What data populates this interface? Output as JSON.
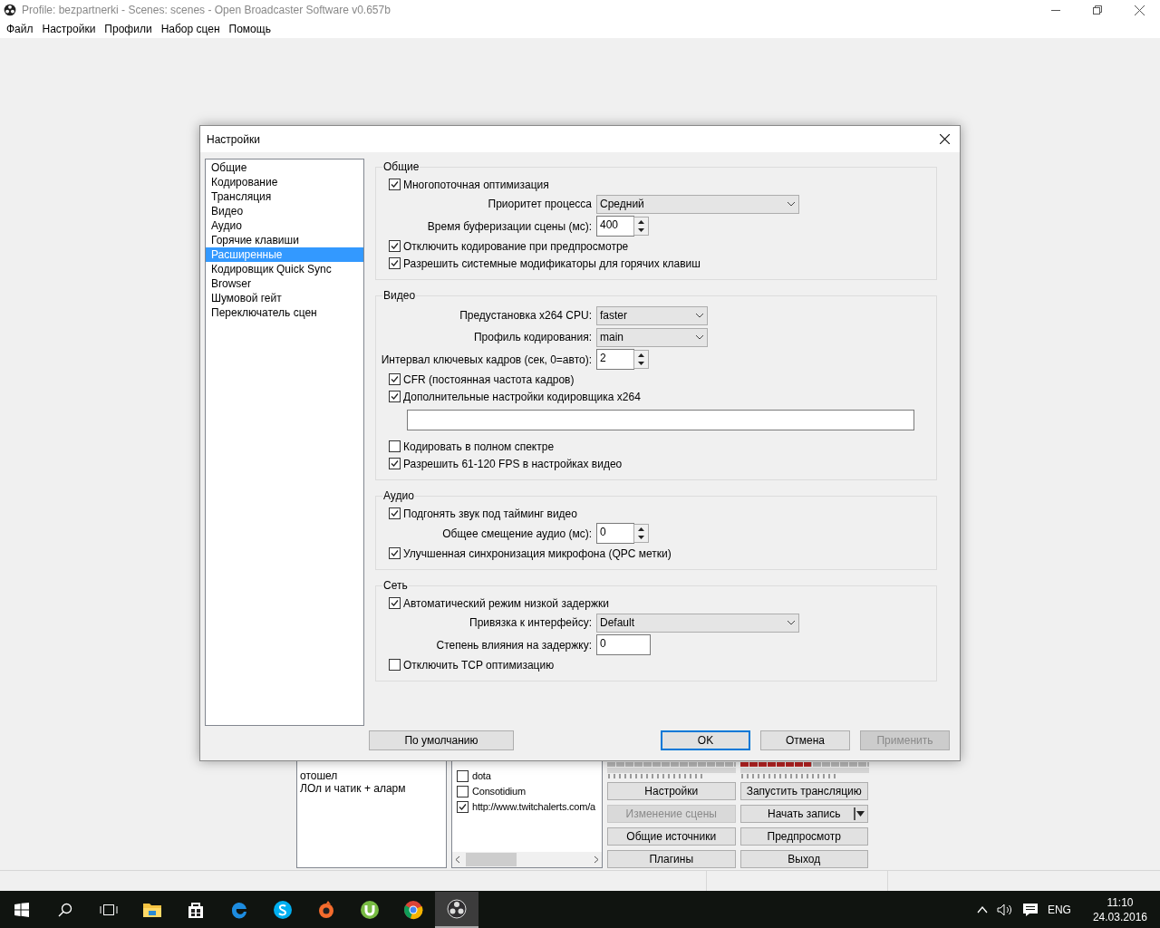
{
  "window": {
    "title": "Profile: bezpartnerki - Scenes: scenes - Open Broadcaster Software v0.657b"
  },
  "menu": [
    "Файл",
    "Настройки",
    "Профили",
    "Набор сцен",
    "Помощь"
  ],
  "main": {
    "scenes": [
      "отошел",
      "ЛОл и чатик + аларм"
    ],
    "sources": [
      {
        "label": "dota",
        "checked": false
      },
      {
        "label": "Consotidium",
        "checked": false
      },
      {
        "label": "http://www.twitchalerts.com/a",
        "checked": true
      }
    ],
    "meters": [
      {
        "level": 0
      },
      {
        "level": 0.55
      }
    ],
    "buttons": [
      {
        "label": "Настройки",
        "disabled": false,
        "kind": "plain"
      },
      {
        "label": "Запустить трансляцию",
        "disabled": false,
        "kind": "plain"
      },
      {
        "label": "Изменение сцены",
        "disabled": true,
        "kind": "plain"
      },
      {
        "label": "Начать запись",
        "disabled": false,
        "kind": "split"
      },
      {
        "label": "Общие источники",
        "disabled": false,
        "kind": "plain"
      },
      {
        "label": "Предпросмотр",
        "disabled": false,
        "kind": "plain"
      },
      {
        "label": "Плагины",
        "disabled": false,
        "kind": "plain"
      },
      {
        "label": "Выход",
        "disabled": false,
        "kind": "plain"
      }
    ]
  },
  "dialog": {
    "title": "Настройки",
    "nav": [
      {
        "label": "Общие",
        "selected": false
      },
      {
        "label": "Кодирование",
        "selected": false
      },
      {
        "label": "Трансляция",
        "selected": false
      },
      {
        "label": "Видео",
        "selected": false
      },
      {
        "label": "Аудио",
        "selected": false
      },
      {
        "label": "Горячие клавиши",
        "selected": false
      },
      {
        "label": "Расширенные",
        "selected": true
      },
      {
        "label": "Кодировщик Quick Sync",
        "selected": false
      },
      {
        "label": "Browser",
        "selected": false
      },
      {
        "label": "Шумовой гейт",
        "selected": false
      },
      {
        "label": "Переключатель сцен",
        "selected": false
      }
    ],
    "groups": [
      {
        "title": "Общие",
        "rows": [
          {
            "kind": "checkbox",
            "label": "Многопоточная оптимизация",
            "checked": true
          },
          {
            "kind": "dropdown",
            "label": "Приоритет процесса",
            "value": "Средний",
            "wide": true
          },
          {
            "kind": "spin",
            "label": "Время буферизации сцены (мс):",
            "value": "400"
          },
          {
            "kind": "checkbox",
            "label": "Отключить кодирование при предпросмотре",
            "checked": true
          },
          {
            "kind": "checkbox",
            "label": "Разрешить системные модификаторы для горячих клавиш",
            "checked": true
          }
        ]
      },
      {
        "title": "Видео",
        "rows": [
          {
            "kind": "dropdown",
            "label": "Предустановка x264 CPU:",
            "value": "faster",
            "wide": false
          },
          {
            "kind": "dropdown",
            "label": "Профиль кодирования:",
            "value": "main",
            "wide": false
          },
          {
            "kind": "spin",
            "label": "Интервал ключевых кадров (сек, 0=авто):",
            "value": "2"
          },
          {
            "kind": "checkbox",
            "label": "CFR (постоянная частота кадров)",
            "checked": true
          },
          {
            "kind": "checkbox",
            "label": "Дополнительные настройки кодировщика x264",
            "checked": true
          },
          {
            "kind": "field"
          },
          {
            "kind": "checkbox",
            "label": "Кодировать в полном спектре",
            "checked": false
          },
          {
            "kind": "checkbox",
            "label": "Разрешить 61-120 FPS в настройках видео",
            "checked": true
          }
        ]
      },
      {
        "title": "Аудио",
        "rows": [
          {
            "kind": "checkbox",
            "label": "Подгонять звук под тайминг видео",
            "checked": true
          },
          {
            "kind": "spin",
            "label": "Общее смещение аудио (мс):",
            "value": "0"
          },
          {
            "kind": "checkbox",
            "label": "Улучшенная синхронизация микрофона (QPC метки)",
            "checked": true
          }
        ]
      },
      {
        "title": "Сеть",
        "rows": [
          {
            "kind": "checkbox",
            "label": "Автоматический режим низкой задержки",
            "checked": true
          },
          {
            "kind": "dropdown",
            "label": "Привязка к интерфейсу:",
            "value": "Default",
            "wide": true
          },
          {
            "kind": "text",
            "label": "Степень влияния на задержку:",
            "value": "0"
          },
          {
            "kind": "checkbox",
            "label": "Отключить TCP оптимизацию",
            "checked": false
          }
        ]
      }
    ],
    "buttons": [
      {
        "label": "По умолчанию",
        "kind": "plain"
      },
      {
        "label": "OK",
        "kind": "primary"
      },
      {
        "label": "Отмена",
        "kind": "plain"
      },
      {
        "label": "Применить",
        "kind": "disabled"
      }
    ]
  },
  "taskbar": {
    "apps": [
      {
        "kind": "explorer",
        "active": false
      },
      {
        "kind": "store",
        "active": false
      },
      {
        "kind": "edge",
        "active": false
      },
      {
        "kind": "skype",
        "active": false
      },
      {
        "kind": "origin",
        "active": false
      },
      {
        "kind": "utorrent",
        "active": false
      },
      {
        "kind": "chrome",
        "active": false
      },
      {
        "kind": "obs",
        "active": true
      }
    ],
    "language": "ENG",
    "time": "11:10",
    "date": "24.03.2016"
  }
}
